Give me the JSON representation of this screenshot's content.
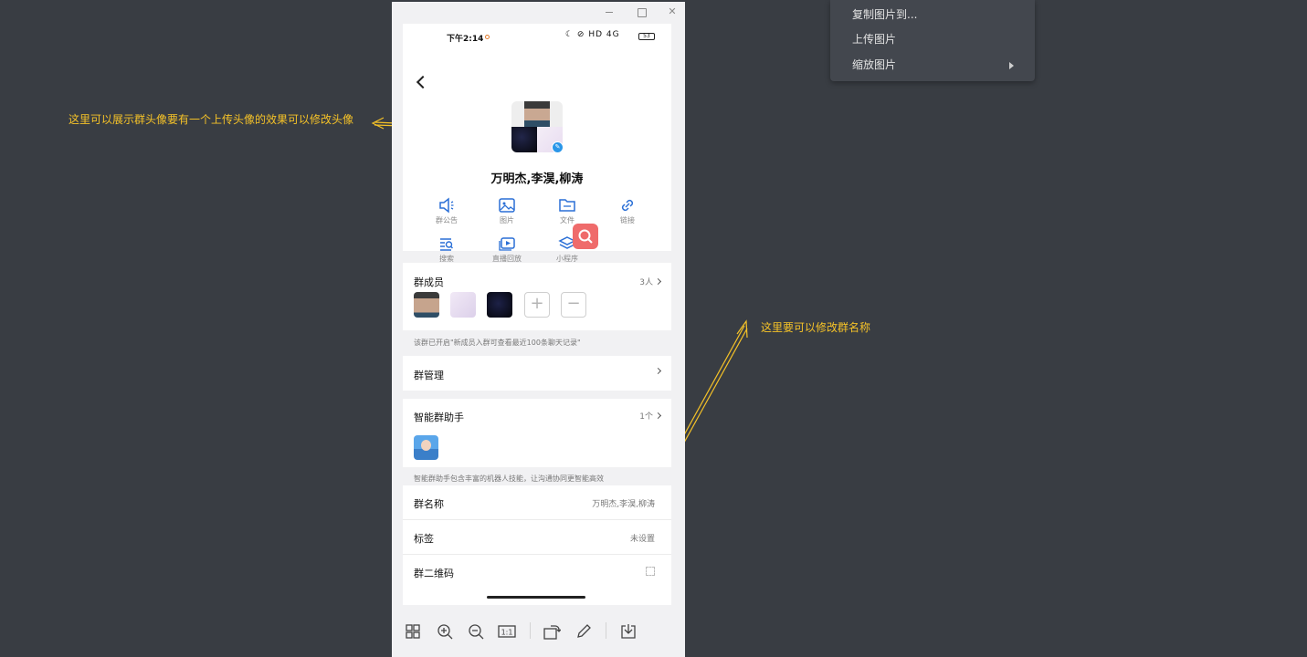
{
  "context_menu": {
    "items": [
      {
        "label": "复制图片到..."
      },
      {
        "label": "上传图片"
      },
      {
        "label": "缩放图片",
        "has_submenu": true
      }
    ]
  },
  "annotations": [
    {
      "text": "这里可以展示群头像要有一个上传头像的效果可以修改头像"
    },
    {
      "text": "这里要可以修改群名称"
    }
  ],
  "status_bar": {
    "time": "下午2:14",
    "icons": "☾ ⊘ HD 4G",
    "battery": "53"
  },
  "group": {
    "name": "万明杰,李淏,柳涛"
  },
  "functions": [
    {
      "label": "群公告",
      "icon": "speaker-icon"
    },
    {
      "label": "图片",
      "icon": "image-icon"
    },
    {
      "label": "文件",
      "icon": "folder-icon"
    },
    {
      "label": "链接",
      "icon": "link-icon"
    },
    {
      "label": "搜索",
      "icon": "search-list-icon"
    },
    {
      "label": "直播回放",
      "icon": "replay-icon"
    },
    {
      "label": "小程序",
      "icon": "layers-icon"
    }
  ],
  "members": {
    "title": "群成员",
    "count": "3人",
    "add_label": "+",
    "remove_label": "−"
  },
  "history_notice": "该群已开启\"新成员入群可查看最近100条聊天记录\"",
  "group_manage": {
    "title": "群管理"
  },
  "assistant": {
    "title": "智能群助手",
    "count": "1个",
    "note": "智能群助手包含丰富的机器人技能，让沟通协同更智能高效"
  },
  "settings": [
    {
      "label": "群名称",
      "value": "万明杰,李淏,柳涛"
    },
    {
      "label": "标签",
      "value": "未设置"
    },
    {
      "label": "群二维码",
      "value": ""
    }
  ],
  "toolbar": {
    "tools": [
      "grid-icon",
      "zoom-in-icon",
      "zoom-out-icon",
      "actual-size-icon",
      "rotate-icon",
      "edit-icon",
      "download-icon"
    ],
    "actual_size_label": "1:1"
  },
  "colors": {
    "background": "#393d43",
    "annotation": "#f5c228",
    "accent": "#2a6fd6",
    "search_fab": "#ef6b6b"
  }
}
